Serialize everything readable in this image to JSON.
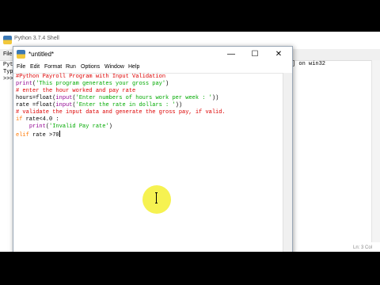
{
  "shell": {
    "title": "Python 3.7.4 Shell",
    "menu_first": "File",
    "lines": [
      "Pyt",
      "Typ",
      ">>>"
    ],
    "right_text": "] on win32",
    "status": "Ln: 3  Col"
  },
  "editor": {
    "title": "*untitled*",
    "menu": [
      "File",
      "Edit",
      "Format",
      "Run",
      "Options",
      "Window",
      "Help"
    ],
    "minimize": "—",
    "maximize": "☐",
    "close": "✕",
    "code": {
      "l1": "#Python Payroll Program with Input Validation",
      "l2_fn": "print",
      "l2_open": "(",
      "l2_str": "'This program generates your gross pay'",
      "l2_close": ")",
      "l3": "# enter the hour worked and pay rate",
      "l4_a": "hours=float(",
      "l4_fn": "input",
      "l4_open": "(",
      "l4_str": "'Enter numbers of hours work per week : '",
      "l4_close": "))",
      "l5_a": "rate =float(",
      "l5_fn": "input",
      "l5_open": "(",
      "l5_str": "'Enter the rate in dollars : '",
      "l5_close": "))",
      "l6": "# validate the input data and generate the gross pay, if valid.",
      "l7_kw": "if",
      "l7_rest": " rate<4.0 :",
      "l8_indent": "    ",
      "l8_fn": "print",
      "l8_open": "(",
      "l8_str": "'Invalid Pay rate'",
      "l8_close": ")",
      "l9_kw": "elif",
      "l9_rest": " rate >70"
    }
  }
}
